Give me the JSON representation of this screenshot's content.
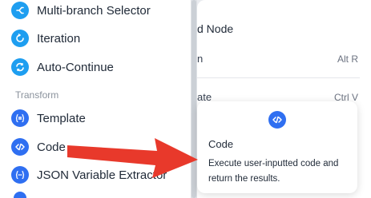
{
  "left_panel": {
    "items": [
      {
        "label": "Multi-branch Selector",
        "icon": "multi-branch-icon",
        "color": "#1e9ef0"
      },
      {
        "label": "Iteration",
        "icon": "iteration-icon",
        "color": "#1e9ef0"
      },
      {
        "label": "Auto-Continue",
        "icon": "auto-continue-icon",
        "color": "#1e9ef0"
      }
    ],
    "section": "Transform",
    "transform_items": [
      {
        "label": "Template",
        "icon": "template-icon",
        "color": "#2f6ff1"
      },
      {
        "label": "Code",
        "icon": "code-icon",
        "color": "#2f6ff1"
      },
      {
        "label": "JSON Variable Extractor",
        "icon": "json-extractor-icon",
        "color": "#2f6ff1"
      }
    ]
  },
  "context_menu": {
    "title": "d Node",
    "rows": [
      {
        "label": "n",
        "shortcut": "Alt R"
      },
      {
        "label": "ate",
        "shortcut": "Ctrl V"
      }
    ]
  },
  "tooltip": {
    "icon": "code-icon",
    "title": "Code",
    "description": "Execute user-inputted code and return the results."
  },
  "annotation": {
    "color": "#e8392b"
  }
}
